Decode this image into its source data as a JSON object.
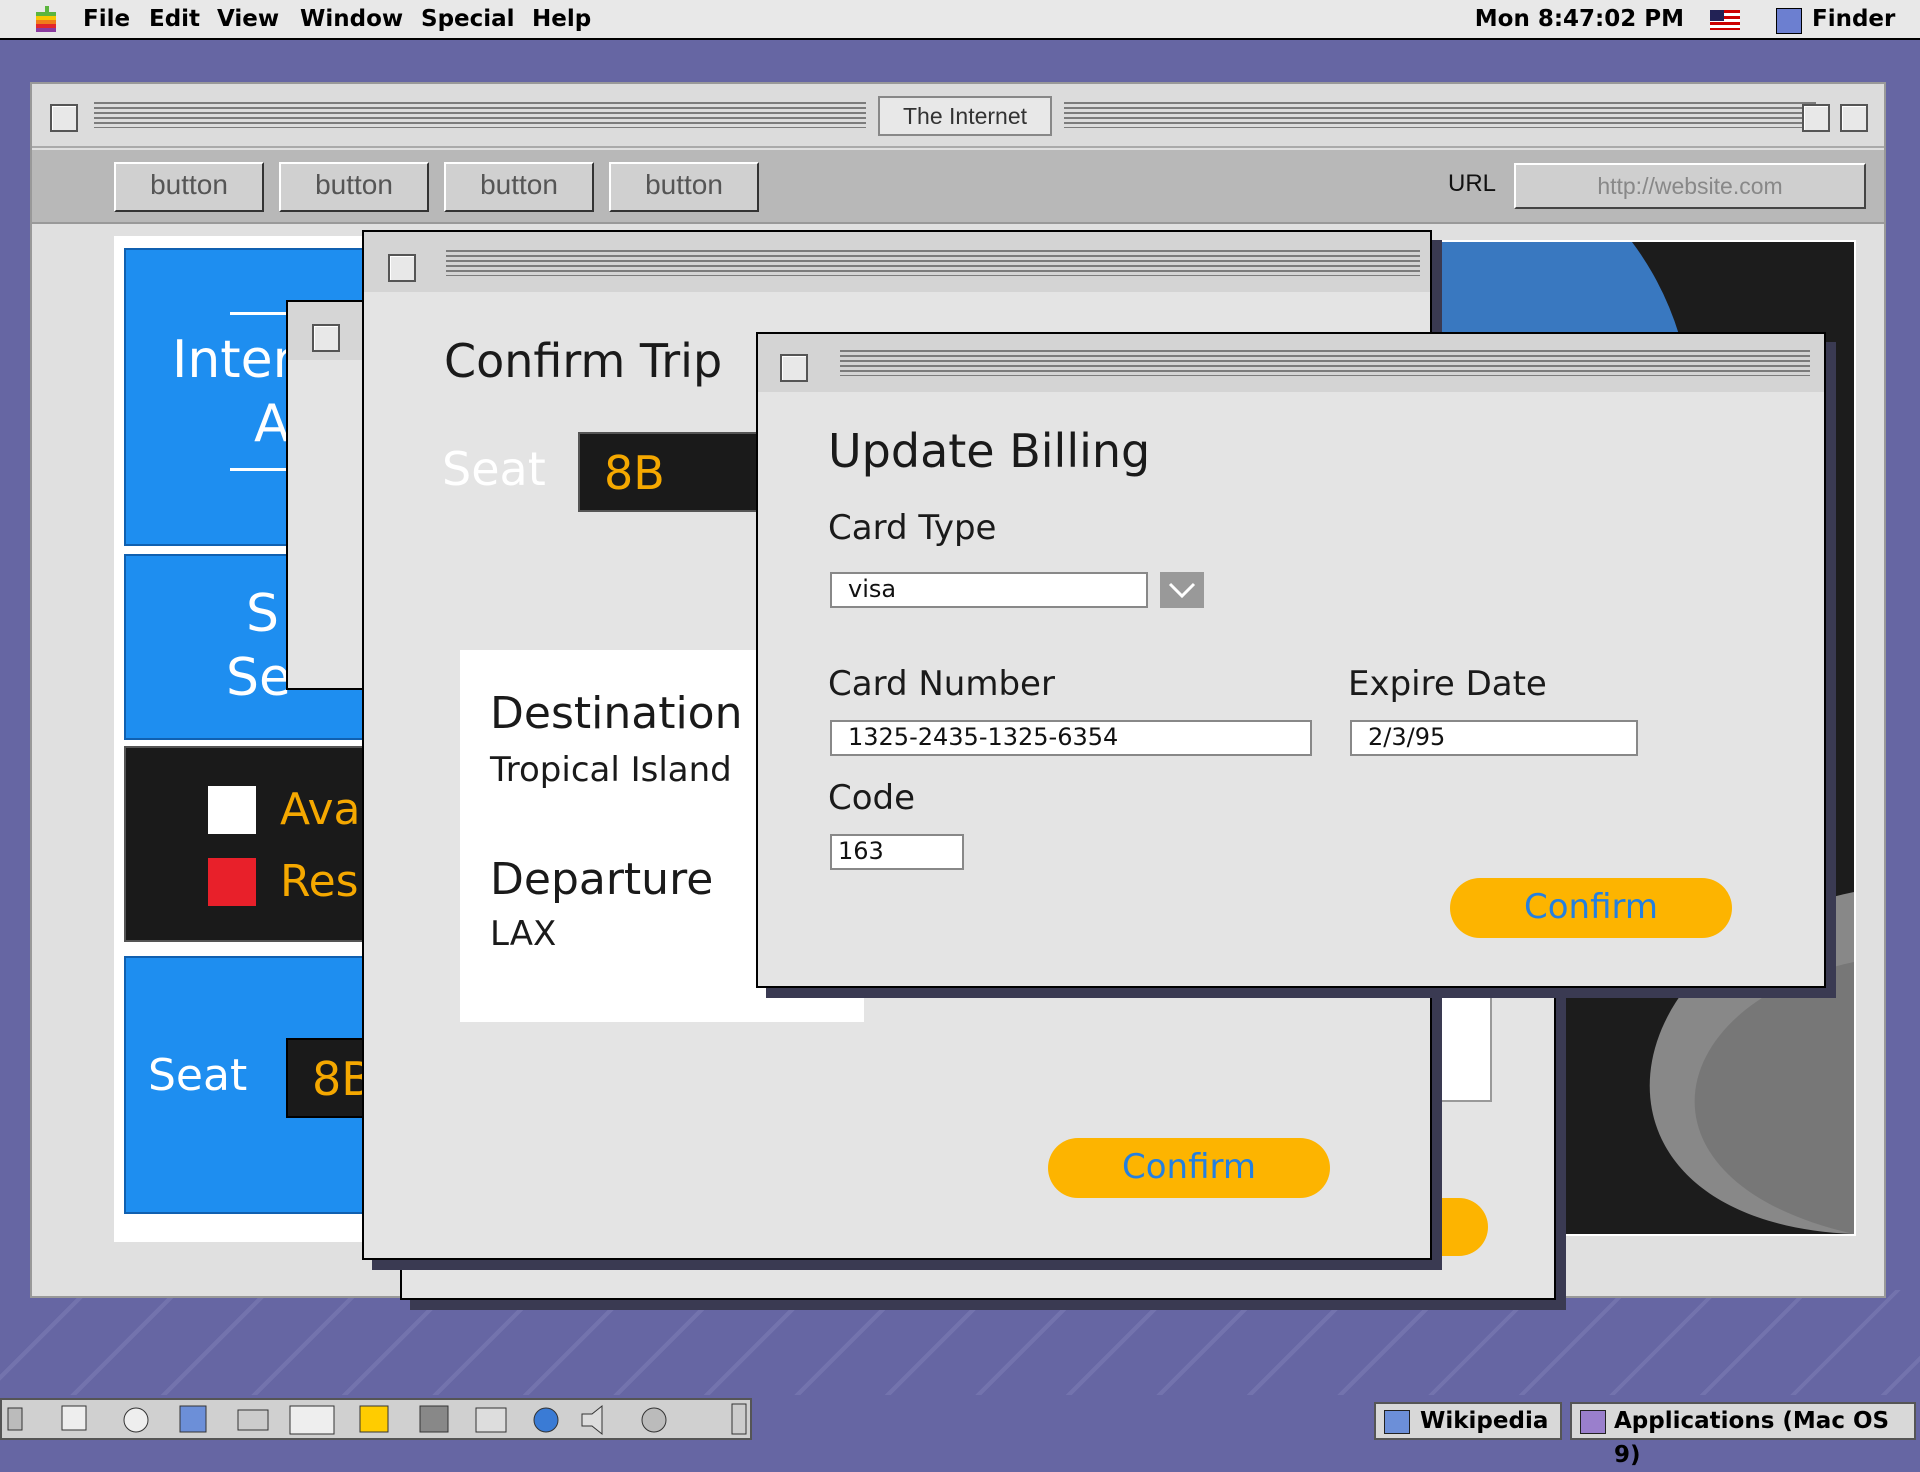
{
  "menubar": {
    "items": [
      "File",
      "Edit",
      "View",
      "Window",
      "Special",
      "Help"
    ],
    "clock": "Mon 8:47:02 PM",
    "app": "Finder"
  },
  "browser": {
    "title": "The Internet",
    "buttons": [
      "button",
      "button",
      "button",
      "button"
    ],
    "url_label": "URL",
    "url_placeholder": "http://website.com"
  },
  "back_page": {
    "panel1_line1": "Inter",
    "panel1_line2": "A",
    "panel2_line1": "S",
    "panel2_line2": "Se",
    "legend_available": "Ava",
    "legend_reserved": "Res",
    "seat_label": "Seat",
    "seat_value": "8B"
  },
  "confirm_trip": {
    "heading": "Confirm Trip",
    "seat_label": "Seat",
    "seat_value": "8B",
    "destination_label": "Destination",
    "destination_value": "Tropical Island",
    "departure_label": "Departure",
    "departure_value": "LAX",
    "confirm_label": "Confirm"
  },
  "update_billing": {
    "heading": "Update Billing",
    "card_type_label": "Card Type",
    "card_type_value": "visa",
    "card_number_label": "Card Number",
    "card_number_value": "1325-2435-1325-6354",
    "expire_label": "Expire Date",
    "expire_value": "2/3/95",
    "code_label": "Code",
    "code_value": "163",
    "confirm_label": "Confirm"
  },
  "taskbar": {
    "item1": "Wikipedia",
    "item2": "Applications (Mac OS 9)"
  },
  "colors": {
    "desktop": "#6666a3",
    "accent_blue": "#1e8ef0",
    "confirm_yellow": "#fdb400",
    "seat_orange": "#f5a800"
  }
}
